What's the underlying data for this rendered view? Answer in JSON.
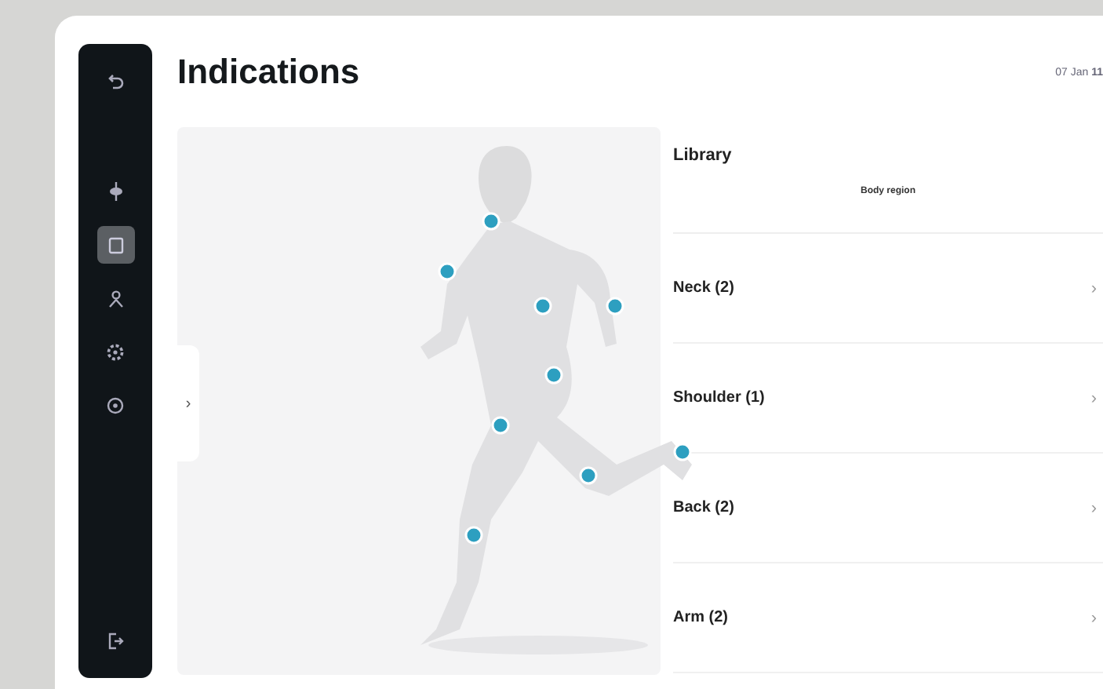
{
  "title": "Indications",
  "datetime": "07 Jan **11**",
  "nav": [
    {
      "kind": "back",
      "selected": false
    },
    {
      "kind": "spine",
      "selected": false
    },
    {
      "kind": "document",
      "selected": true
    },
    {
      "kind": "person",
      "selected": false
    },
    {
      "kind": "gear",
      "selected": false
    },
    {
      "kind": "help",
      "selected": false
    },
    {
      "kind": "logout",
      "selected": false
    }
  ],
  "panel_toggle": "›",
  "library": {
    "title": "Library",
    "subtitle": "Body region",
    "items": [
      {
        "label": "Neck (2)",
        "chevron": "›"
      },
      {
        "label": "Shoulder (1)",
        "chevron": "›"
      },
      {
        "label": "Back (2)",
        "chevron": "›"
      },
      {
        "label": "Arm (2)",
        "chevron": "›"
      }
    ]
  }
}
